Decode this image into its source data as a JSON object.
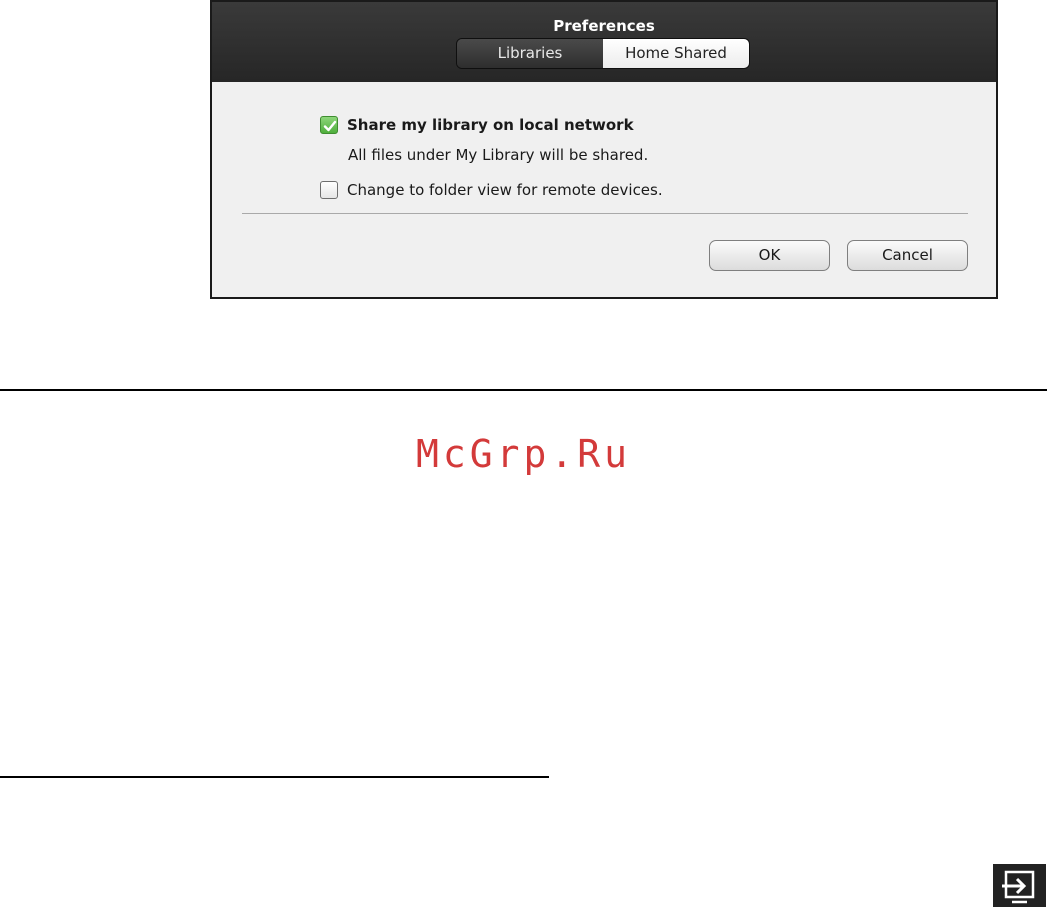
{
  "dialog": {
    "title": "Preferences",
    "tabs": [
      {
        "label": "Libraries",
        "active": false
      },
      {
        "label": "Home Shared",
        "active": true
      }
    ],
    "options": {
      "share": {
        "label": "Share my library on local network",
        "checked": true
      },
      "share_description": "All files under My Library will be shared.",
      "folder_view": {
        "label": "Change to folder view for remote devices.",
        "checked": false
      }
    },
    "buttons": {
      "ok": "OK",
      "cancel": "Cancel"
    }
  },
  "watermark": "McGrp.Ru",
  "icons": {
    "check": "check-icon",
    "corner": "input-source-icon"
  },
  "colors": {
    "header": "#2b2b2b",
    "check_green": "#5bb347",
    "watermark_red": "#d33a3a"
  }
}
